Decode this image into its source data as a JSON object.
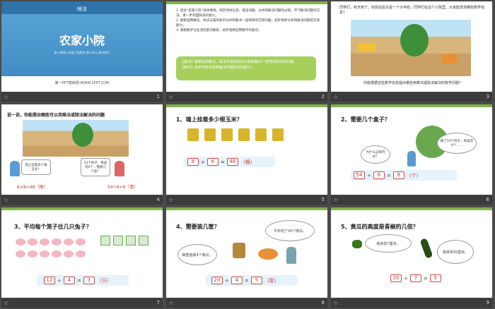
{
  "slides": {
    "s1": {
      "unit": "除法",
      "title": "农家小院",
      "subtitle": "新人教版二年级下册数学 第二单元 表内除法",
      "site": "第一PPT模板网-WWW.1PPT.COM",
      "num": "1"
    },
    "s2": {
      "goals": [
        "1. 结合“农家小院”具体情境，经历寻找信息、提出问题、分析和解决问题的过程，学习解决问题的方法，进一步巩固除法的意义。",
        "2. 能够运用乘法、除法与倍的知识分析和解决一些简单的实际问题，初步培养分析和解决问题的实际能力。",
        "3. 感受数学与生活的密切联系，初步培养应用数学的意识。"
      ],
      "focus_label": "【重点】",
      "focus": "能够运用乘法、除法与倍的知识分析和解决一些简单的实际问题。",
      "diff_label": "【难点】",
      "diff": "初步培养分析和解决问题的实际能力。",
      "num": "2"
    },
    "s3": {
      "intro": "同学们，秋天到了，农民伯伯又是一个大丰收，同学们在这个小院里，大家能发现哪些数学信息？",
      "question": "你能根据这些数学信息提出哪些用乘法或除法解决的数学问题？",
      "num": "3"
    },
    "s4": {
      "title": "说一说，你能提出哪些可以用乘法或除法解决的问题",
      "bubble_left": "墙上挂着多少根玉米？",
      "bubble_right": "54个柿子，每盒装6个，需要几个盒？",
      "eq_left": "6×8=48（根）",
      "eq_right": "54÷6=9（盒）",
      "num": "4"
    },
    "s5": {
      "title": "1、墙上挂着多少根玉米？",
      "a": "8",
      "op": "×",
      "b": "6",
      "eqsign": "=",
      "r": "48",
      "unit": "（根）",
      "num": "5"
    },
    "s6": {
      "title": "2、需要几个盒子？",
      "bubble_q": "为什么这样列式？",
      "bubble_info": "摘了54个柿子，每盒装6个……",
      "a": "54",
      "op": "÷",
      "b": "6",
      "eqsign": "=",
      "r": "9",
      "unit": "（个）",
      "num": "6"
    },
    "s7": {
      "title": "3、平均每个笼子住几只兔子？",
      "a": "12",
      "op": "÷",
      "b": "4",
      "eqsign": "=",
      "r": "3",
      "unit": "（只）",
      "num": "7"
    },
    "s8": {
      "title": "4、需要装几筐？",
      "bubble_top": "今年结了20个南瓜。",
      "bubble_left": "每筐能装4个南瓜。",
      "a": "20",
      "op": "÷",
      "b": "4",
      "eqsign": "=",
      "r": "5",
      "unit": "（筐）",
      "num": "8"
    },
    "s9": {
      "title": "5、黄瓜的高度是青椒的几倍？",
      "bubble_left": "我身高7厘米。",
      "bubble_right": "我身高35厘米。",
      "a": "35",
      "op": "÷",
      "b": "7",
      "eqsign": "=",
      "r": "5",
      "num": "9"
    }
  }
}
